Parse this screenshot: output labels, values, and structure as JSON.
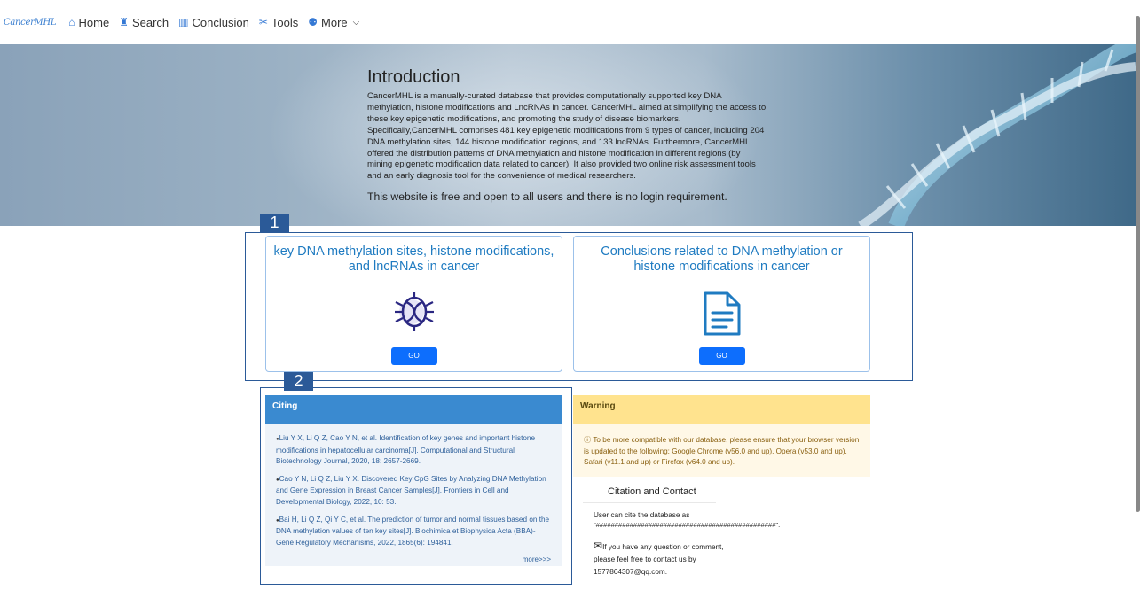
{
  "nav": {
    "logo": "CancerMHL",
    "items": [
      {
        "label": "Home",
        "icon": "⌂"
      },
      {
        "label": "Search",
        "icon": "♜"
      },
      {
        "label": "Conclusion",
        "icon": "▥"
      },
      {
        "label": "Tools",
        "icon": "✂"
      },
      {
        "label": "More",
        "icon": "⚉"
      }
    ]
  },
  "intro": {
    "title": "Introduction",
    "body": "CancerMHL is a manually-curated database that provides computationally supported key DNA methylation, histone modifications and LncRNAs in cancer. CancerMHL aimed at simplifying the access to these key epigenetic modifications, and promoting the study of disease biomarkers. Specifically,CancerMHL comprises 481 key epigenetic modifications from 9 types of cancer, including 204 DNA methylation sites, 144 histone modification regions, and 133 lncRNAs. Furthermore, CancerMHL offered the distribution patterns of DNA methylation and histone modification in different regions (by mining epigenetic modification data related to cancer). It also provided two online risk assessment tools and an early diagnosis tool for the convenience of medical researchers.",
    "free": "This website is free and open to all users and there is no login requirement."
  },
  "markers": {
    "one": "1",
    "two": "2"
  },
  "cards": [
    {
      "title": "key DNA methylation sites, histone modifications, and lncRNAs in cancer",
      "button": "GO",
      "icon": "dna-bug-icon"
    },
    {
      "title": "Conclusions related to DNA methylation or histone modifications in cancer",
      "button": "GO",
      "icon": "document-icon"
    }
  ],
  "citing": {
    "title": "Citing",
    "refs": [
      "Liu Y X, Li Q Z, Cao Y N, et al. Identification of key genes and important histone modifications in hepatocellular carcinoma[J]. Computational and Structural Biotechnology Journal, 2020, 18: 2657-2669.",
      "Cao Y N, Li Q Z, Liu Y X. Discovered Key CpG Sites by Analyzing DNA Methylation and Gene Expression in Breast Cancer Samples[J]. Frontiers in Cell and Developmental Biology, 2022, 10: 53.",
      "Bai H, Li Q Z, Qi Y C, et al. The prediction of tumor and normal tissues based on the DNA methylation values of ten key sites[J]. Biochimica et Biophysica Acta (BBA)-Gene Regulatory Mechanisms, 2022, 1865(6): 194841."
    ],
    "more": "more>>>"
  },
  "warning": {
    "title": "Warning",
    "message": "To be more compatible with our database, please ensure that your browser version is updated to the following: Google Chrome (v56.0 and up), Opera (v53.0 and up), Safari (v11.1 and up) or Firefox (v64.0 and up)."
  },
  "contact": {
    "title": "Citation and Contact",
    "cite_text": "User can cite the database as",
    "hash": "\"################################################\".",
    "mail_text": "If you have any question or comment, please feel free to contact us by 1577864307@qq.com."
  },
  "colors": {
    "accent": "#1f7bc1",
    "button": "#0d6efd",
    "citing_head": "#3a8ad0",
    "warning_head": "#ffe38e",
    "marker": "#2b5a98"
  }
}
